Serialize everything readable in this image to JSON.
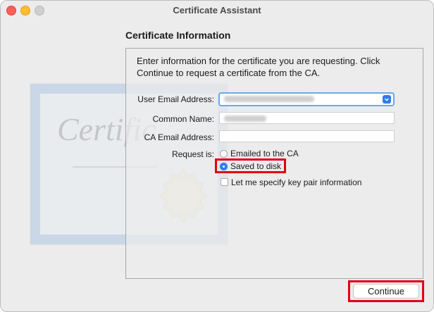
{
  "window": {
    "title": "Certificate Assistant"
  },
  "section_title": "Certificate Information",
  "intro_text": "Enter information for the certificate you are requesting. Click Continue to request a certificate from the CA.",
  "watermark_text": "Certific",
  "form": {
    "user_email_label": "User Email Address:",
    "common_name_label": "Common Name:",
    "ca_email_label": "CA Email Address:",
    "ca_email_value": "",
    "request_label": "Request is:",
    "option_emailed": "Emailed to the CA",
    "option_saved": "Saved to disk",
    "selected_option": "Saved to disk",
    "key_pair_label": "Let me specify key pair information",
    "key_pair_checked": false
  },
  "continue_label": "Continue",
  "colors": {
    "highlight": "#e00010",
    "accent": "#2e7cf6"
  }
}
